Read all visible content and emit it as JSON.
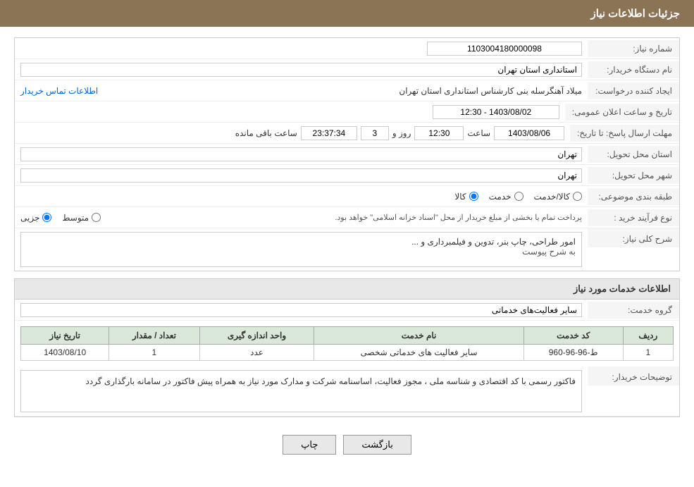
{
  "header": {
    "title": "جزئیات اطلاعات نیاز"
  },
  "fields": {
    "need_number_label": "شماره نیاز:",
    "need_number_value": "1103004180000098",
    "buyer_org_label": "نام دستگاه خریدار:",
    "buyer_org_value": "استانداری استان تهران",
    "creator_label": "ایجاد کننده درخواست:",
    "creator_value": "میلاد آهنگرسله بنی کارشناس استانداری استان تهران",
    "creator_link": "اطلاعات تماس خریدار",
    "public_announce_label": "تاریخ و ساعت اعلان عمومی:",
    "public_announce_value": "1403/08/02 - 12:30",
    "response_deadline_label": "مهلت ارسال پاسخ: تا تاریخ:",
    "response_date": "1403/08/06",
    "response_time": "12:30",
    "response_days": "3",
    "response_seconds": "23:37:34",
    "remaining_label": "ساعت باقی مانده",
    "days_label": "روز و",
    "delivery_province_label": "استان محل تحویل:",
    "delivery_province_value": "تهران",
    "delivery_city_label": "شهر محل تحویل:",
    "delivery_city_value": "تهران",
    "category_label": "طبقه بندی موضوعی:",
    "category_options": [
      "کالا",
      "خدمت",
      "کالا/خدمت"
    ],
    "category_selected": "کالا",
    "process_type_label": "نوع فرآیند خرید :",
    "process_options": [
      "جزیی",
      "متوسط"
    ],
    "process_note": "پرداخت تمام یا بخشی از مبلغ خریدار از محل \"اسناد خزانه اسلامی\" خواهد بود.",
    "need_description_label": "شرح کلی نیاز:",
    "need_description_value": "امور طراحی، چاپ بنر، تدوین و فیلمبرداری و ...",
    "need_description_sub": "به شرح پیوست",
    "services_info_title": "اطلاعات خدمات مورد نیاز",
    "service_group_label": "گروه خدمت:",
    "service_group_value": "سایر فعالیت‌های خدماتی",
    "table": {
      "headers": [
        "ردیف",
        "کد خدمت",
        "نام خدمت",
        "واحد اندازه گیری",
        "تعداد / مقدار",
        "تاریخ نیاز"
      ],
      "rows": [
        {
          "row": "1",
          "code": "ط-96-96-960",
          "name": "سایر فعالیت های خدماتی شخصی",
          "unit": "عدد",
          "quantity": "1",
          "date": "1403/08/10"
        }
      ]
    },
    "buyer_notes_label": "توضیحات خریدار:",
    "buyer_notes_value": "فاکتور رسمی با کد اقتصادی و شناسه ملی ، مجوز فعالیت، اساسنامه شرکت و مدارک مورد نیاز به همراه پیش فاکتور در سامانه بارگذاری گردد"
  },
  "buttons": {
    "print_label": "چاپ",
    "back_label": "بازگشت"
  }
}
